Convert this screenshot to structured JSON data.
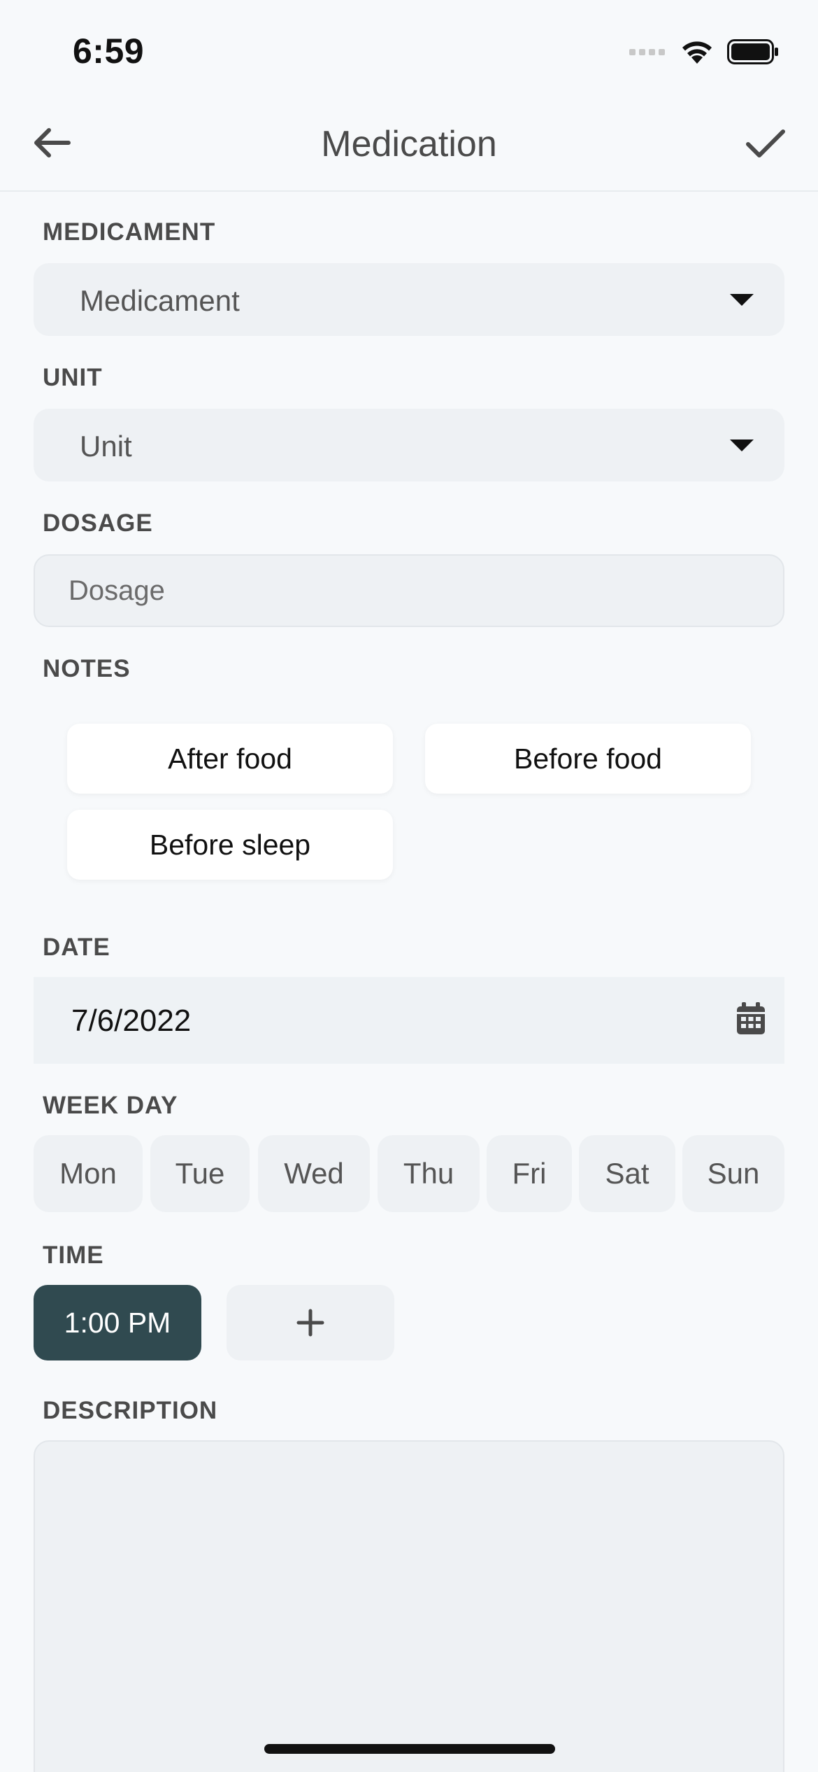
{
  "status_bar": {
    "time": "6:59"
  },
  "nav": {
    "title": "Medication"
  },
  "form": {
    "medicament": {
      "label": "MEDICAMENT",
      "value": "Medicament"
    },
    "unit": {
      "label": "UNIT",
      "value": "Unit"
    },
    "dosage": {
      "label": "DOSAGE",
      "placeholder": "Dosage"
    },
    "notes": {
      "label": "NOTES",
      "options": [
        "After food",
        "Before food",
        "Before sleep"
      ]
    },
    "date": {
      "label": "DATE",
      "value": "7/6/2022"
    },
    "week_day": {
      "label": "WEEK DAY",
      "days": [
        "Mon",
        "Tue",
        "Wed",
        "Thu",
        "Fri",
        "Sat",
        "Sun"
      ]
    },
    "time": {
      "label": "TIME",
      "times": [
        "1:00 PM"
      ],
      "add_label": "+"
    },
    "description": {
      "label": "DESCRIPTION"
    }
  },
  "colors": {
    "background": "#f7f9fb",
    "field": "#eef1f4",
    "selected_time": "#304a50",
    "chip": "#ffffff"
  },
  "icons": {
    "back": "arrow-left-icon",
    "confirm": "checkmark-icon",
    "caret": "caret-down-icon",
    "calendar": "calendar-icon",
    "signal": "cellular-signal-icon",
    "wifi": "wifi-icon",
    "battery": "battery-icon"
  }
}
